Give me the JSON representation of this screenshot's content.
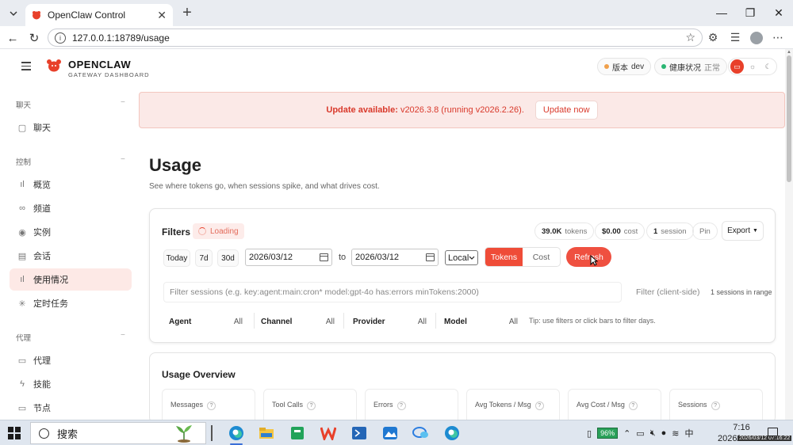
{
  "browser": {
    "tab_title": "OpenClaw Control",
    "url": "127.0.0.1:18789/usage"
  },
  "header": {
    "brand_name": "OPENCLAW",
    "brand_sub": "GATEWAY DASHBOARD",
    "version_label": "版本",
    "version_value": "dev",
    "health_label": "健康状况",
    "health_value": "正常"
  },
  "sidebar": {
    "sections": [
      {
        "title": "聊天",
        "items": [
          {
            "label": "聊天",
            "icon": "chat-icon"
          }
        ]
      },
      {
        "title": "控制",
        "items": [
          {
            "label": "概览",
            "icon": "bar-chart-icon"
          },
          {
            "label": "频道",
            "icon": "link-icon"
          },
          {
            "label": "实例",
            "icon": "radio-icon"
          },
          {
            "label": "会话",
            "icon": "document-icon"
          },
          {
            "label": "使用情况",
            "icon": "usage-bars-icon",
            "active": true
          },
          {
            "label": "定时任务",
            "icon": "cron-icon"
          }
        ]
      },
      {
        "title": "代理",
        "items": [
          {
            "label": "代理",
            "icon": "folder-icon"
          },
          {
            "label": "技能",
            "icon": "bolt-icon"
          },
          {
            "label": "节点",
            "icon": "monitor-icon"
          }
        ]
      }
    ]
  },
  "banner": {
    "prefix": "Update available:",
    "message": "v2026.3.8 (running v2026.2.26).",
    "button": "Update now"
  },
  "page": {
    "title": "Usage",
    "subtitle": "See where tokens go, when sessions spike, and what drives cost."
  },
  "filters": {
    "label": "Filters",
    "loading": "Loading",
    "tokens_value": "39.0K",
    "tokens_label": "tokens",
    "cost_value": "$0.00",
    "cost_label": "cost",
    "session_value": "1",
    "session_label": "session",
    "pin": "Pin",
    "export": "Export",
    "today": "Today",
    "d7": "7d",
    "d30": "30d",
    "date_from": "2026/03/12",
    "to": "to",
    "date_to": "2026/03/12",
    "timezone": "Local",
    "mode_tokens": "Tokens",
    "mode_cost": "Cost",
    "refresh": "Refresh",
    "query_placeholder": "Filter sessions (e.g. key:agent:main:cron* model:gpt-4o has:errors minTokens:2000)",
    "client_side": "Filter (client-side)",
    "sessions_in_range": "1 sessions in range",
    "facets": [
      {
        "label": "Agent",
        "value": "All"
      },
      {
        "label": "Channel",
        "value": "All"
      },
      {
        "label": "Provider",
        "value": "All"
      },
      {
        "label": "Model",
        "value": "All"
      }
    ],
    "tip": "Tip: use filters or click bars to filter days."
  },
  "overview": {
    "title": "Usage Overview",
    "metrics": [
      "Messages",
      "Tool Calls",
      "Errors",
      "Avg Tokens / Msg",
      "Avg Cost / Msg",
      "Sessions"
    ]
  },
  "taskbar": {
    "search": "搜索",
    "battery": "96%",
    "ime": "中",
    "time": "7:16",
    "date": "2026/",
    "stamp": "2026/03/12 07:16:22"
  },
  "colors": {
    "accent": "#ef4c38",
    "active_nav_bg": "#fde9e6",
    "banner_bg": "#fbe9e7"
  }
}
